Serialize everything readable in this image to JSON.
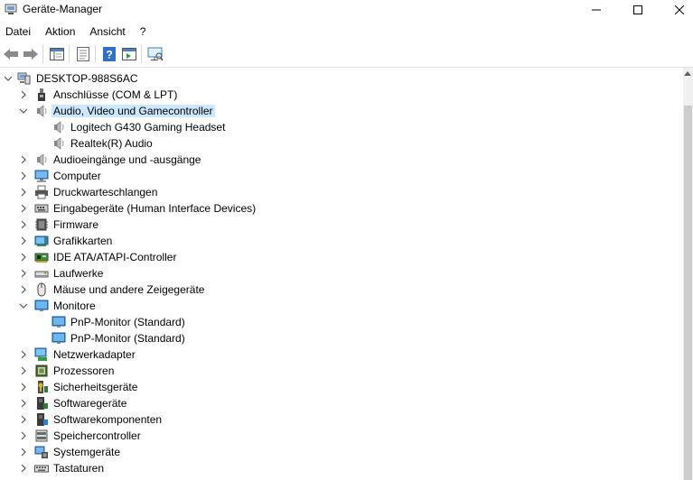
{
  "window": {
    "title": "Geräte-Manager",
    "controls": {
      "minimize": "—",
      "maximize": "☐",
      "close": "✕"
    }
  },
  "menu": [
    "Datei",
    "Aktion",
    "Ansicht",
    "?"
  ],
  "toolbar": [
    {
      "name": "back-icon"
    },
    {
      "name": "forward-icon"
    },
    {
      "name": "show-hide-console-tree-icon"
    },
    {
      "name": "properties-icon"
    },
    {
      "name": "help-icon"
    },
    {
      "name": "action-pane-icon"
    },
    {
      "name": "scan-hardware-icon"
    }
  ],
  "tree": {
    "root": "DESKTOP-988S6AC",
    "nodes": [
      {
        "label": "Anschlüsse (COM & LPT)",
        "icon": "port-icon",
        "expanded": false
      },
      {
        "label": "Audio, Video und Gamecontroller",
        "icon": "speaker-icon",
        "expanded": true,
        "selected": true,
        "children": [
          "Logitech G430 Gaming Headset",
          "Realtek(R) Audio"
        ],
        "child_icon": "speaker-icon"
      },
      {
        "label": "Audioeingänge und -ausgänge",
        "icon": "speaker-icon",
        "expanded": false
      },
      {
        "label": "Computer",
        "icon": "computer-icon",
        "expanded": false
      },
      {
        "label": "Druckwarteschlangen",
        "icon": "printer-icon",
        "expanded": false
      },
      {
        "label": "Eingabegeräte (Human Interface Devices)",
        "icon": "hid-icon",
        "expanded": false
      },
      {
        "label": "Firmware",
        "icon": "firmware-icon",
        "expanded": false
      },
      {
        "label": "Grafikkarten",
        "icon": "display-adapter-icon",
        "expanded": false
      },
      {
        "label": "IDE ATA/ATAPI-Controller",
        "icon": "ide-controller-icon",
        "expanded": false
      },
      {
        "label": "Laufwerke",
        "icon": "drive-icon",
        "expanded": false
      },
      {
        "label": "Mäuse und andere Zeigegeräte",
        "icon": "mouse-icon",
        "expanded": false
      },
      {
        "label": "Monitore",
        "icon": "monitor-icon",
        "expanded": true,
        "children": [
          "PnP-Monitor (Standard)",
          "PnP-Monitor (Standard)"
        ],
        "child_icon": "monitor-icon"
      },
      {
        "label": "Netzwerkadapter",
        "icon": "network-adapter-icon",
        "expanded": false
      },
      {
        "label": "Prozessoren",
        "icon": "processor-icon",
        "expanded": false
      },
      {
        "label": "Sicherheitsgeräte",
        "icon": "security-device-icon",
        "expanded": false
      },
      {
        "label": "Softwaregeräte",
        "icon": "software-device-icon",
        "expanded": false
      },
      {
        "label": "Softwarekomponenten",
        "icon": "software-component-icon",
        "expanded": false
      },
      {
        "label": "Speichercontroller",
        "icon": "storage-controller-icon",
        "expanded": false
      },
      {
        "label": "Systemgeräte",
        "icon": "system-device-icon",
        "expanded": false
      },
      {
        "label": "Tastaturen",
        "icon": "keyboard-icon",
        "expanded": false
      }
    ]
  },
  "colors": {
    "selection": "#cce8ff",
    "accent": "#2f7fd0"
  }
}
